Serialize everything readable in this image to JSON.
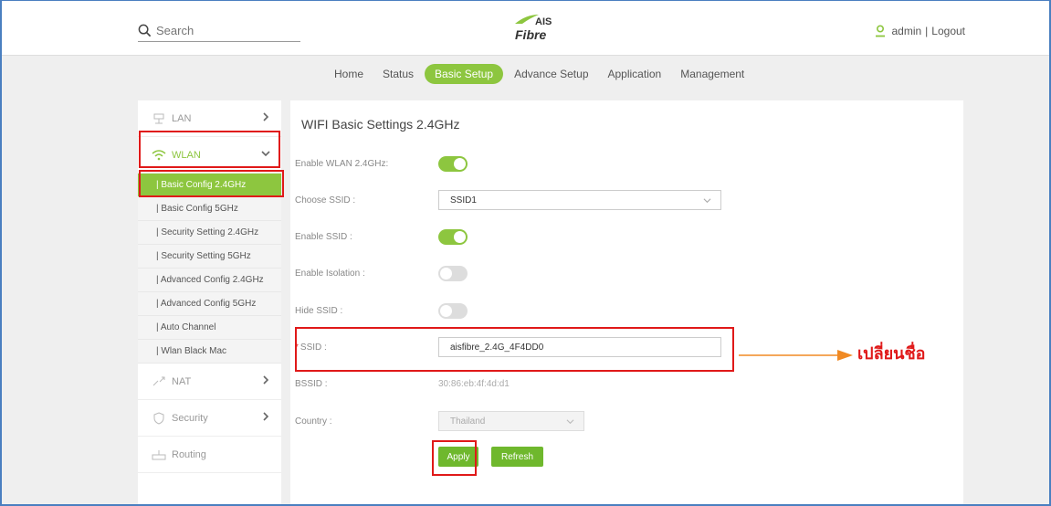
{
  "header": {
    "search_placeholder": "Search",
    "logo_top": "AIS",
    "logo_bottom": "Fibre",
    "user_name": "admin",
    "separator": "|",
    "logout_label": "Logout"
  },
  "nav": {
    "items": [
      "Home",
      "Status",
      "Basic Setup",
      "Advance Setup",
      "Application",
      "Management"
    ],
    "active_index": 2
  },
  "sidebar": {
    "groups": {
      "lan": "LAN",
      "wlan": "WLAN",
      "nat": "NAT",
      "security": "Security",
      "routing": "Routing"
    },
    "wlan_items": [
      "| Basic Config 2.4GHz",
      "| Basic Config 5GHz",
      "| Security Setting 2.4GHz",
      "| Security Setting 5GHz",
      "| Advanced Config 2.4GHz",
      "| Advanced Config 5GHz",
      "| Auto Channel",
      "| Wlan Black Mac"
    ],
    "active_item_index": 0
  },
  "panel": {
    "title": "WIFI Basic Settings 2.4GHz",
    "enable_wlan": {
      "label": "Enable WLAN 2.4GHz:",
      "on": true
    },
    "choose_ssid": {
      "label": "Choose SSID :",
      "value": "SSID1"
    },
    "enable_ssid": {
      "label": "Enable SSID :",
      "on": true
    },
    "enable_isolation": {
      "label": "Enable Isolation :",
      "on": false
    },
    "hide_ssid": {
      "label": "Hide SSID :",
      "on": false
    },
    "ssid": {
      "required_mark": "*",
      "label": "SSID :",
      "value": "aisfibre_2.4G_4F4DD0"
    },
    "bssid": {
      "label": "BSSID :",
      "value": "30:86:eb:4f:4d:d1"
    },
    "country": {
      "label": "Country :",
      "value": "Thailand"
    },
    "apply_label": "Apply",
    "refresh_label": "Refresh"
  },
  "annotation": {
    "note": "เปลี่ยนชื่อ",
    "highlight_color": "#e01919",
    "arrow_color": "#f08a24"
  },
  "colors": {
    "accent": "#8dc63f",
    "button": "#6fb82d",
    "frame": "#4a7fc0"
  }
}
